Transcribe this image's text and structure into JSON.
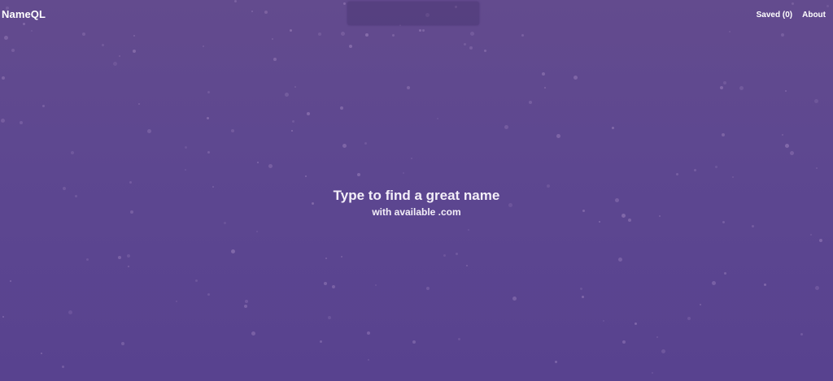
{
  "header": {
    "logo_text": "NameQL",
    "search": {
      "value": "",
      "placeholder": ""
    },
    "nav": {
      "saved_label": "Saved (0)",
      "about_label": "About"
    }
  },
  "hero": {
    "title": "Type to find a great name",
    "subtitle": "with available .com"
  },
  "colors": {
    "background_top": "#634b8e",
    "background_bottom": "#58428f",
    "text": "#ffffff"
  }
}
